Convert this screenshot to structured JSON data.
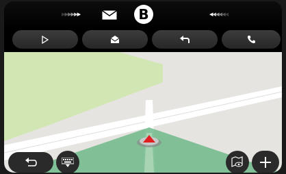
{
  "notification": {
    "left_arrows_icon": "chevrons-right-icon",
    "mail_icon": "envelope-icon",
    "source_badge": "B",
    "right_arrows_icon": "chevrons-left-icon"
  },
  "actions": [
    {
      "name": "play",
      "icon": "play-icon"
    },
    {
      "name": "open-message",
      "icon": "open-envelope-icon"
    },
    {
      "name": "reply",
      "icon": "reply-icon"
    },
    {
      "name": "call",
      "icon": "phone-icon"
    }
  ],
  "bottom_controls": {
    "back_icon": "back-arrow-icon",
    "keyboard_icon": "keyboard-icon",
    "map_view_icon": "map-eye-icon",
    "zoom_in_icon": "plus-icon"
  },
  "colors": {
    "map_grey": "#e6e4e0",
    "park_green": "#d2e6b4",
    "road_white": "#ffffff",
    "view_cone": "#6fb98a",
    "position_marker": "#e02020"
  }
}
